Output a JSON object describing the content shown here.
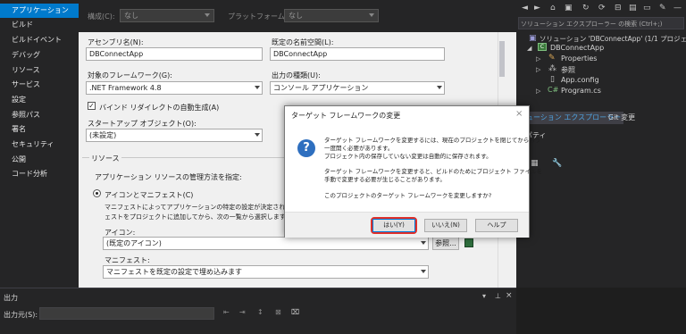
{
  "leftnav": {
    "items": [
      "アプリケーション",
      "ビルド",
      "ビルドイベント",
      "デバッグ",
      "リソース",
      "サービス",
      "設定",
      "参照パス",
      "署名",
      "セキュリティ",
      "公開",
      "コード分析"
    ],
    "active_index": 0
  },
  "top": {
    "config_label": "構成(C):",
    "config_value": "なし",
    "platform_label": "プラットフォーム(M):",
    "platform_value": "なし"
  },
  "form": {
    "assembly_label": "アセンブリ名(N):",
    "assembly_value": "DBConnectApp",
    "namespace_label": "既定の名前空間(L):",
    "namespace_value": "DBConnectApp",
    "framework_label": "対象のフレームワーク(G):",
    "framework_value": ".NET Framework 4.8",
    "output_type_label": "出力の種類(U):",
    "output_type_value": "コンソール アプリケーション",
    "binding_label": "バインド リダイレクトの自動生成(A)",
    "startup_label": "スタートアップ オブジェクト(O):",
    "startup_value": "(未設定)",
    "resources_header": "リソース",
    "resources_desc": "アプリケーション リソースの管理方法を指定:",
    "icon_manifest_label": "アイコンとマニフェスト(C)",
    "manifest_desc_1": "マニフェストによってアプリケーションの特定の設定が決定されます。",
    "manifest_desc_2": "ェストをプロジェクトに追加してから、次の一覧から選択します。",
    "icon_label": "アイコン:",
    "icon_value": "(既定のアイコン)",
    "browse_label": "参照...",
    "manifest_label": "マニフェスト:",
    "manifest_value": "マニフェストを既定の設定で埋め込みます"
  },
  "solution": {
    "search_placeholder": "ソリューション エクスプローラー の検索 (Ctrl+;)",
    "solution_label": "ソリューション 'DBConnectApp' (1/1 プロジェクト)",
    "project_label": "DBConnectApp",
    "items": [
      "Properties",
      "参照",
      "App.config",
      "Program.cs"
    ],
    "tab_solution": "リューション エクスプローラー",
    "tab_git": "Git 変更",
    "properties_title": "ロパティ"
  },
  "output": {
    "title": "出力",
    "from_label": "出力元(S):"
  },
  "dialog": {
    "title": "ターゲット フレームワークの変更",
    "close": "×",
    "icon": "?",
    "msg1_line1": "ターゲット フレームワークを変更するには、現在のプロジェクトを閉じてからもう",
    "msg1_line2": "一度開く必要があります。",
    "msg1_line3": "プロジェクト内の保存していない変更は自動的に保存されます。",
    "msg2_line1": "ターゲット フレームワークを変更すると、ビルドのためにプロジェクト ファイルを",
    "msg2_line2": "手動で変更する必要が生じることがあります。",
    "msg3": "このプロジェクトのターゲット フレームワークを変更しますか?",
    "yes": "はい(Y)",
    "no": "いいえ(N)",
    "help": "ヘルプ"
  },
  "colors": {
    "accent": "#007acc",
    "highlight_ring": "#e0302a",
    "dark_bg": "#252526",
    "panel_bg": "#f0f0f0"
  }
}
